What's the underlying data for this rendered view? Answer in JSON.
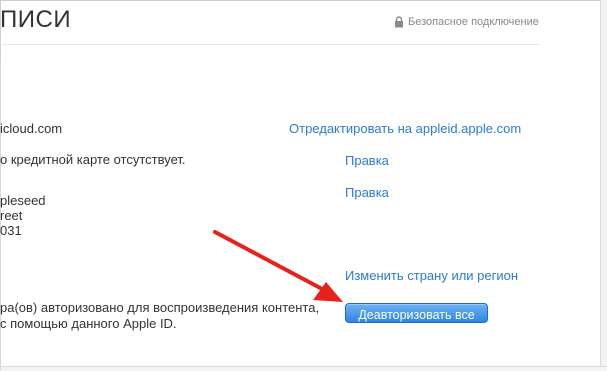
{
  "header": {
    "title": "ПИСИ",
    "secure_label": "Безопасное подключение"
  },
  "account": {
    "email_fragment": "icloud.com",
    "edit_appleid_link": "Отредактировать на appleid.apple.com"
  },
  "payment": {
    "text": "о кредитной карте отсутствует.",
    "edit_link": "Правка"
  },
  "address": {
    "line1": "pleseed",
    "line2": "reet",
    "line3": "031",
    "edit_link": "Правка"
  },
  "country": {
    "change_link": "Изменить страну или регион"
  },
  "devices": {
    "line1": "ра(ов) авторизовано для воспроизведения контента,",
    "line2": "с помощью данного Apple ID.",
    "deauthorize_button": "Деавторизовать все"
  },
  "colors": {
    "link": "#2b7ad3",
    "button": "#2f86e3",
    "arrow": "#e8211c"
  },
  "icons": [
    "lock-icon",
    "red-arrow-annotation"
  ]
}
